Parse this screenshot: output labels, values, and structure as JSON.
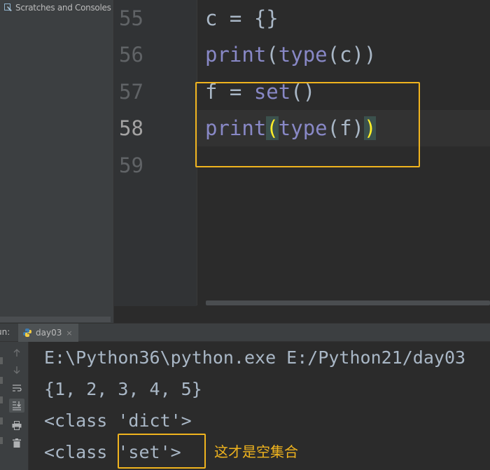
{
  "sidebar": {
    "scratches_label": "Scratches and Consoles",
    "scratches_icon": "scratches-icon"
  },
  "editor": {
    "line_numbers": [
      "55",
      "56",
      "57",
      "58",
      "59"
    ],
    "current_line": "58",
    "lines": [
      {
        "plain_a": "c = {}"
      },
      {
        "builtin_a": "print",
        "plain_a": "(",
        "builtin_b": "type",
        "plain_b": "(c))"
      },
      {
        "plain_a": "f = ",
        "builtin_a": "set",
        "plain_b": "()"
      },
      {
        "builtin_a": "print",
        "match_open": "(",
        "builtin_b": "type",
        "plain_b": "(f)",
        "match_close": ")"
      },
      {}
    ]
  },
  "run_panel": {
    "run_label": "un:",
    "tab_label": "day03",
    "tab_icon": "python-icon",
    "tab_close": "×",
    "toolbar_icons": [
      "arrow-up-icon",
      "arrow-down-icon",
      "soft-wrap-icon",
      "scroll-to-end-icon",
      "print-icon",
      "trash-icon"
    ],
    "output": [
      "E:\\Python36\\python.exe E:/Python21/day03",
      "{1, 2, 3, 4, 5}",
      "<class 'dict'>",
      "<class 'set'>"
    ]
  },
  "annotation": {
    "text": "这才是空集合"
  },
  "colors": {
    "highlight_box": "#f0b41e",
    "builtin": "#8888c6",
    "default_text": "#a9b7c6",
    "bracket_match": "#ffef28"
  }
}
